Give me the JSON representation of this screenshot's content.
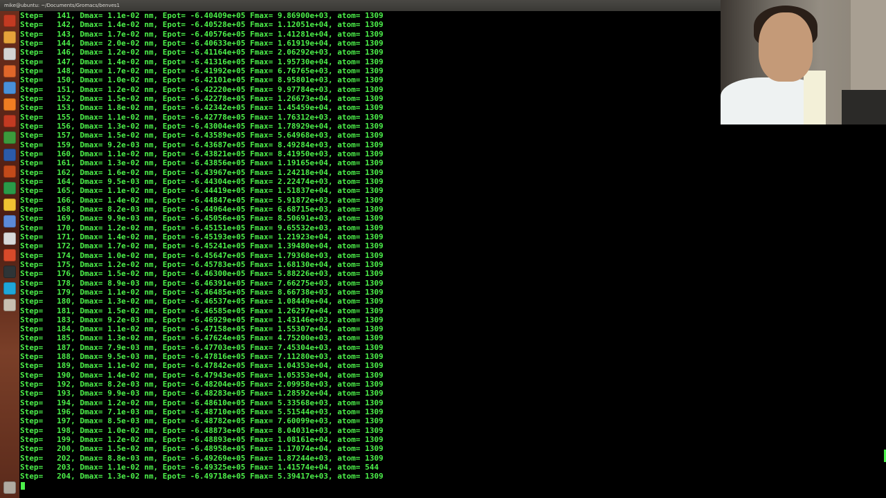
{
  "window": {
    "title": "mike@ubuntu: ~/Documents/Gromacs/benves1"
  },
  "launcher": {
    "items": [
      {
        "name": "dash-icon",
        "color": "#c23a22"
      },
      {
        "name": "files-icon",
        "color": "#e6a23a"
      },
      {
        "name": "files-alt-icon",
        "color": "#d3d3d3"
      },
      {
        "name": "firefox-icon",
        "color": "#e0662a"
      },
      {
        "name": "chromium-icon",
        "color": "#4a90d9"
      },
      {
        "name": "software-center-icon",
        "color": "#f07d22"
      },
      {
        "name": "tools-icon",
        "color": "#c23a22"
      },
      {
        "name": "settings-icon",
        "color": "#3c9a3c"
      },
      {
        "name": "word-icon",
        "color": "#2b5aa8"
      },
      {
        "name": "impress-icon",
        "color": "#c24a1a"
      },
      {
        "name": "calc-icon",
        "color": "#2a9a48"
      },
      {
        "name": "drive-icon",
        "color": "#f1c232"
      },
      {
        "name": "browser-icon",
        "color": "#5c8ad8"
      },
      {
        "name": "editor-icon",
        "color": "#d8d8d8"
      },
      {
        "name": "image-viewer-icon",
        "color": "#d84a2a"
      },
      {
        "name": "terminal-icon",
        "color": "#2e3436"
      },
      {
        "name": "skype-icon",
        "color": "#1fa6d8"
      },
      {
        "name": "archive-icon",
        "color": "#c8c0b0"
      },
      {
        "name": "trash-icon",
        "color": "#b0aaa0"
      }
    ]
  },
  "terminal": {
    "text_color": "#4cf04a",
    "lines": [
      "Step=   141, Dmax= 1.1e-02 nm, Epot= -6.40409e+05 Fmax= 9.86900e+03, atom= 1309",
      "Step=   142, Dmax= 1.4e-02 nm, Epot= -6.40528e+05 Fmax= 1.12051e+04, atom= 1309",
      "Step=   143, Dmax= 1.7e-02 nm, Epot= -6.40576e+05 Fmax= 1.41281e+04, atom= 1309",
      "Step=   144, Dmax= 2.0e-02 nm, Epot= -6.40633e+05 Fmax= 1.61919e+04, atom= 1309",
      "Step=   146, Dmax= 1.2e-02 nm, Epot= -6.41164e+05 Fmax= 2.06292e+03, atom= 1309",
      "Step=   147, Dmax= 1.4e-02 nm, Epot= -6.41316e+05 Fmax= 1.95730e+04, atom= 1309",
      "Step=   148, Dmax= 1.7e-02 nm, Epot= -6.41992e+05 Fmax= 6.76765e+03, atom= 1309",
      "Step=   150, Dmax= 1.0e-02 nm, Epot= -6.42101e+05 Fmax= 8.95801e+03, atom= 1309",
      "Step=   151, Dmax= 1.2e-02 nm, Epot= -6.42220e+05 Fmax= 9.97784e+03, atom= 1309",
      "Step=   152, Dmax= 1.5e-02 nm, Epot= -6.42278e+05 Fmax= 1.26673e+04, atom= 1309",
      "Step=   153, Dmax= 1.8e-02 nm, Epot= -6.42342e+05 Fmax= 1.45459e+04, atom= 1309",
      "Step=   155, Dmax= 1.1e-02 nm, Epot= -6.42778e+05 Fmax= 1.76312e+03, atom= 1309",
      "Step=   156, Dmax= 1.3e-02 nm, Epot= -6.43004e+05 Fmax= 1.78929e+04, atom= 1309",
      "Step=   157, Dmax= 1.5e-02 nm, Epot= -6.43589e+05 Fmax= 5.64968e+03, atom= 1309",
      "Step=   159, Dmax= 9.2e-03 nm, Epot= -6.43687e+05 Fmax= 8.49284e+03, atom= 1309",
      "Step=   160, Dmax= 1.1e-02 nm, Epot= -6.43821e+05 Fmax= 8.41950e+03, atom= 1309",
      "Step=   161, Dmax= 1.3e-02 nm, Epot= -6.43856e+05 Fmax= 1.19165e+04, atom= 1309",
      "Step=   162, Dmax= 1.6e-02 nm, Epot= -6.43967e+05 Fmax= 1.24218e+04, atom= 1309",
      "Step=   164, Dmax= 9.5e-03 nm, Epot= -6.44304e+05 Fmax= 2.22474e+03, atom= 1309",
      "Step=   165, Dmax= 1.1e-02 nm, Epot= -6.44419e+05 Fmax= 1.51837e+04, atom= 1309",
      "Step=   166, Dmax= 1.4e-02 nm, Epot= -6.44847e+05 Fmax= 5.91872e+03, atom= 1309",
      "Step=   168, Dmax= 8.2e-03 nm, Epot= -6.44964e+05 Fmax= 6.68715e+03, atom= 1309",
      "Step=   169, Dmax= 9.9e-03 nm, Epot= -6.45056e+05 Fmax= 8.50691e+03, atom= 1309",
      "Step=   170, Dmax= 1.2e-02 nm, Epot= -6.45151e+05 Fmax= 9.65532e+03, atom= 1309",
      "Step=   171, Dmax= 1.4e-02 nm, Epot= -6.45193e+05 Fmax= 1.21923e+04, atom= 1309",
      "Step=   172, Dmax= 1.7e-02 nm, Epot= -6.45241e+05 Fmax= 1.39480e+04, atom= 1309",
      "Step=   174, Dmax= 1.0e-02 nm, Epot= -6.45647e+05 Fmax= 1.79368e+03, atom= 1309",
      "Step=   175, Dmax= 1.2e-02 nm, Epot= -6.45783e+05 Fmax= 1.68130e+04, atom= 1309",
      "Step=   176, Dmax= 1.5e-02 nm, Epot= -6.46300e+05 Fmax= 5.88226e+03, atom= 1309",
      "Step=   178, Dmax= 8.9e-03 nm, Epot= -6.46391e+05 Fmax= 7.66275e+03, atom= 1309",
      "Step=   179, Dmax= 1.1e-02 nm, Epot= -6.46485e+05 Fmax= 8.66738e+03, atom= 1309",
      "Step=   180, Dmax= 1.3e-02 nm, Epot= -6.46537e+05 Fmax= 1.08449e+04, atom= 1309",
      "Step=   181, Dmax= 1.5e-02 nm, Epot= -6.46585e+05 Fmax= 1.26297e+04, atom= 1309",
      "Step=   183, Dmax= 9.2e-03 nm, Epot= -6.46929e+05 Fmax= 1.43146e+03, atom= 1309",
      "Step=   184, Dmax= 1.1e-02 nm, Epot= -6.47158e+05 Fmax= 1.55307e+04, atom= 1309",
      "Step=   185, Dmax= 1.3e-02 nm, Epot= -6.47624e+05 Fmax= 4.75200e+03, atom= 1309",
      "Step=   187, Dmax= 7.9e-03 nm, Epot= -6.47703e+05 Fmax= 7.45304e+03, atom= 1309",
      "Step=   188, Dmax= 9.5e-03 nm, Epot= -6.47816e+05 Fmax= 7.11280e+03, atom= 1309",
      "Step=   189, Dmax= 1.1e-02 nm, Epot= -6.47842e+05 Fmax= 1.04353e+04, atom= 1309",
      "Step=   190, Dmax= 1.4e-02 nm, Epot= -6.47943e+05 Fmax= 1.05353e+04, atom= 1309",
      "Step=   192, Dmax= 8.2e-03 nm, Epot= -6.48204e+05 Fmax= 2.09958e+03, atom= 1309",
      "Step=   193, Dmax= 9.9e-03 nm, Epot= -6.48283e+05 Fmax= 1.28592e+04, atom= 1309",
      "Step=   194, Dmax= 1.2e-02 nm, Epot= -6.48610e+05 Fmax= 5.33568e+03, atom= 1309",
      "Step=   196, Dmax= 7.1e-03 nm, Epot= -6.48710e+05 Fmax= 5.51544e+03, atom= 1309",
      "Step=   197, Dmax= 8.5e-03 nm, Epot= -6.48782e+05 Fmax= 7.60099e+03, atom= 1309",
      "Step=   198, Dmax= 1.0e-02 nm, Epot= -6.48873e+05 Fmax= 8.04031e+03, atom= 1309",
      "Step=   199, Dmax= 1.2e-02 nm, Epot= -6.48893e+05 Fmax= 1.08161e+04, atom= 1309",
      "Step=   200, Dmax= 1.5e-02 nm, Epot= -6.48958e+05 Fmax= 1.17074e+04, atom= 1309",
      "Step=   202, Dmax= 8.8e-03 nm, Epot= -6.49269e+05 Fmax= 1.87244e+03, atom= 1309",
      "Step=   203, Dmax= 1.1e-02 nm, Epot= -6.49325e+05 Fmax= 1.41574e+04, atom= 544",
      "Step=   204, Dmax= 1.3e-02 nm, Epot= -6.49718e+05 Fmax= 5.39417e+03, atom= 1309"
    ]
  }
}
